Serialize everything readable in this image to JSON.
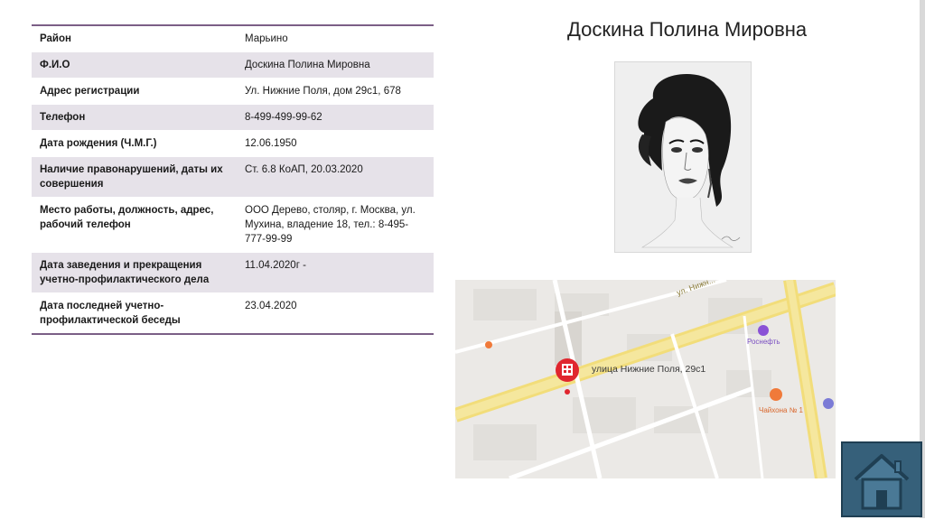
{
  "person_name": "Доскина Полина Мировна",
  "table": {
    "rows": [
      {
        "label": "Район",
        "value": "Марьино"
      },
      {
        "label": "Ф.И.О",
        "value": "Доскина Полина Мировна"
      },
      {
        "label": "Адрес регистрации",
        "value": "Ул. Нижние Поля, дом 29с1, 678"
      },
      {
        "label": "Телефон",
        "value": "8-499-499-99-62"
      },
      {
        "label": "Дата рождения (Ч.М.Г.)",
        "value": "12.06.1950"
      },
      {
        "label": "Наличие правонарушений, даты их совершения",
        "value": "Ст. 6.8 КоАП, 20.03.2020"
      },
      {
        "label": "Место работы, должность, адрес, рабочий телефон",
        "value": "ООО Дерево, столяр, г. Москва, ул. Мухина, владение 18, тел.: 8-495-777-99-99"
      },
      {
        "label": "Дата заведения и прекращения учетно-профилактического дела",
        "value": "11.04.2020г -"
      },
      {
        "label": "Дата последней учетно-профилактической беседы",
        "value": "23.04.2020"
      }
    ]
  },
  "map": {
    "marker_label": "улица Нижние Поля, 29с1",
    "street_label": "ул. Нижн...",
    "poi_1": "Роснефть",
    "poi_2": "Чайхона № 1"
  },
  "colors": {
    "table_accent": "#7b5f86",
    "row_shade": "#e6e2e9",
    "marker": "#e0262e",
    "home_button": "#36607a"
  },
  "icons": {
    "home": "house-icon",
    "marker": "map-pin-icon"
  }
}
